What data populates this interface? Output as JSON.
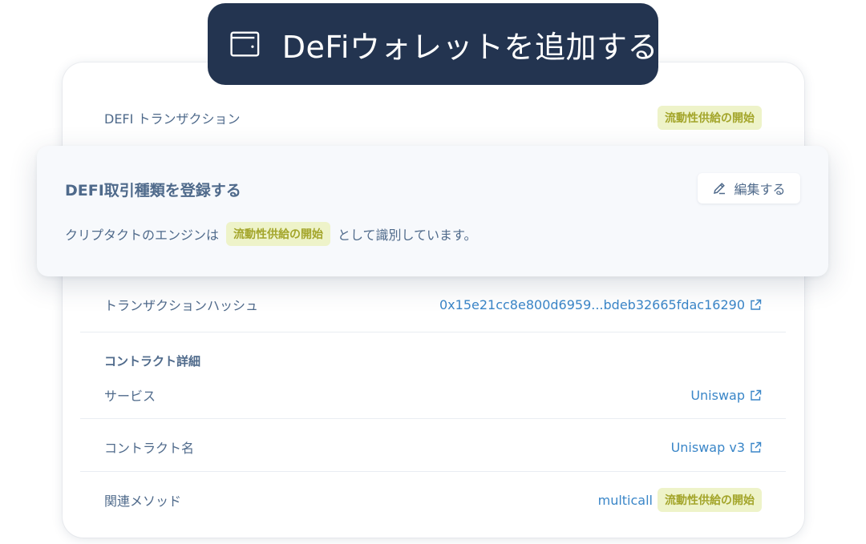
{
  "header": {
    "title": "DeFiウォレットを追加する",
    "icon": "wallet-icon"
  },
  "card": {
    "transaction_label": "DEFI トランザクション",
    "transaction_badge": "流動性供給の開始",
    "hash_label": "トランザクションハッシュ",
    "hash_value": "0x15e21cc8e800d6959...bdeb32665fdac16290",
    "contract_section_title": "コントラクト詳細",
    "service_label": "サービス",
    "service_value": "Uniswap",
    "contract_name_label": "コントラクト名",
    "contract_name_value": "Uniswap v3",
    "method_label": "関連メソッド",
    "method_value": "multicall",
    "method_badge": "流動性供給の開始"
  },
  "overlay": {
    "title": "DEFI取引種類を登録する",
    "edit_label": "編集する",
    "desc_before": "クリプタクトのエンジンは",
    "desc_badge": "流動性供給の開始",
    "desc_after": "として識別しています。"
  },
  "colors": {
    "header_bg": "#233450",
    "badge_bg": "#eef3c9",
    "badge_text": "#a3a52a",
    "link": "#3a86c8",
    "label": "#4f6a8b"
  }
}
